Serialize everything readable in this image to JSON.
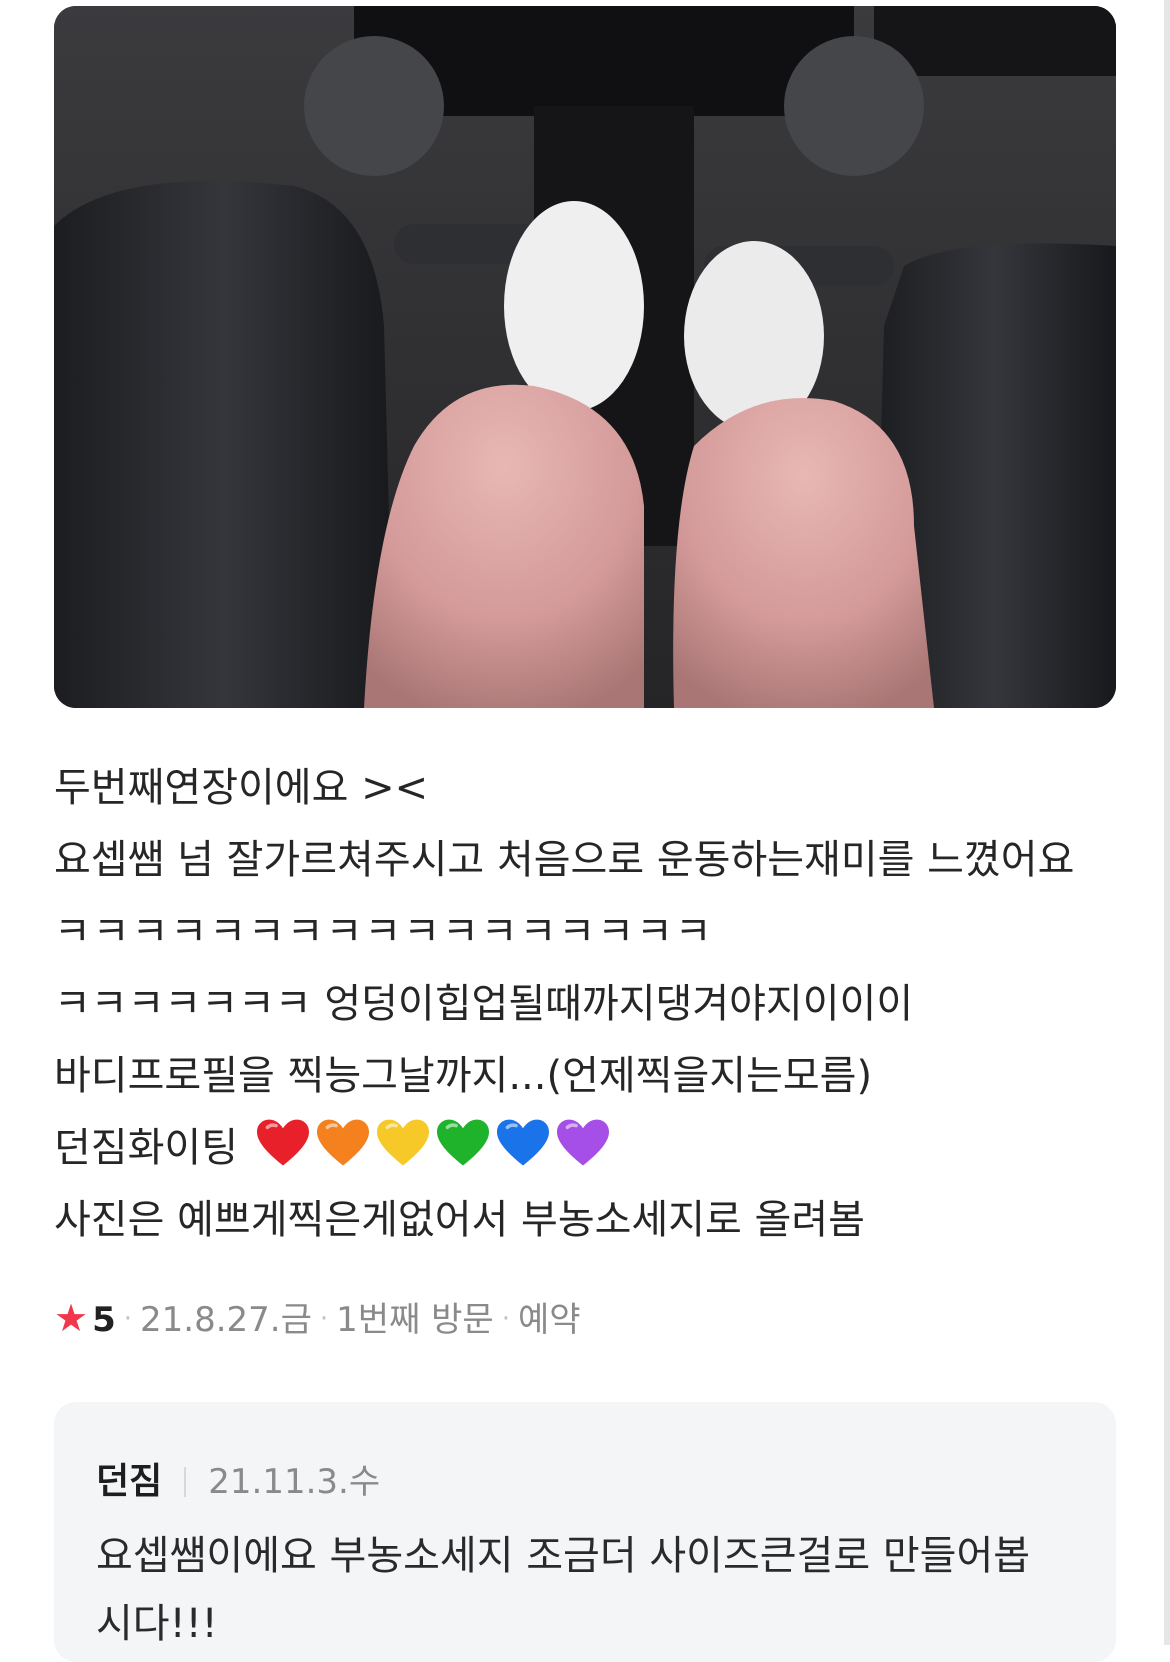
{
  "review": {
    "lines": [
      "두번째연장이에요 ><",
      "요셉쌤 넘 잘가르쳐주시고 처음으로 운동하는재미를 느꼈어요",
      "ㅋㅋㅋㅋㅋㅋㅋㅋㅋㅋㅋㅋㅋㅋㅋㅋㅋ",
      "ㅋㅋㅋㅋㅋㅋㅋ 엉덩이힙업될때까지댕겨야지이이이",
      "바디프로필을 찍능그날까지...(언제찍을지는모름)",
      "던짐화이팅",
      "사진은 예쁘게찍은게없어서 부농소세지로 올려봄"
    ],
    "hearts": [
      {
        "name": "red-heart-icon",
        "color": "#e8202a"
      },
      {
        "name": "orange-heart-icon",
        "color": "#f4811e"
      },
      {
        "name": "yellow-heart-icon",
        "color": "#f7c928"
      },
      {
        "name": "green-heart-icon",
        "color": "#1fb32b"
      },
      {
        "name": "blue-heart-icon",
        "color": "#1a73e8"
      },
      {
        "name": "purple-heart-icon",
        "color": "#a64ee8"
      }
    ]
  },
  "meta": {
    "star": "★",
    "rating": "5",
    "date": "21.8.27.금",
    "visit": "1번째 방문",
    "type": "예약"
  },
  "reply": {
    "author": "던짐",
    "date": "21.11.3.수",
    "text": "요셉쌤이에요 부농소세지 조금더 사이즈큰걸로 만들어봅시다!!!"
  },
  "colors": {
    "star": "#f0374b",
    "meta_text": "#8a8a8a",
    "reply_bg": "#f4f5f7"
  }
}
